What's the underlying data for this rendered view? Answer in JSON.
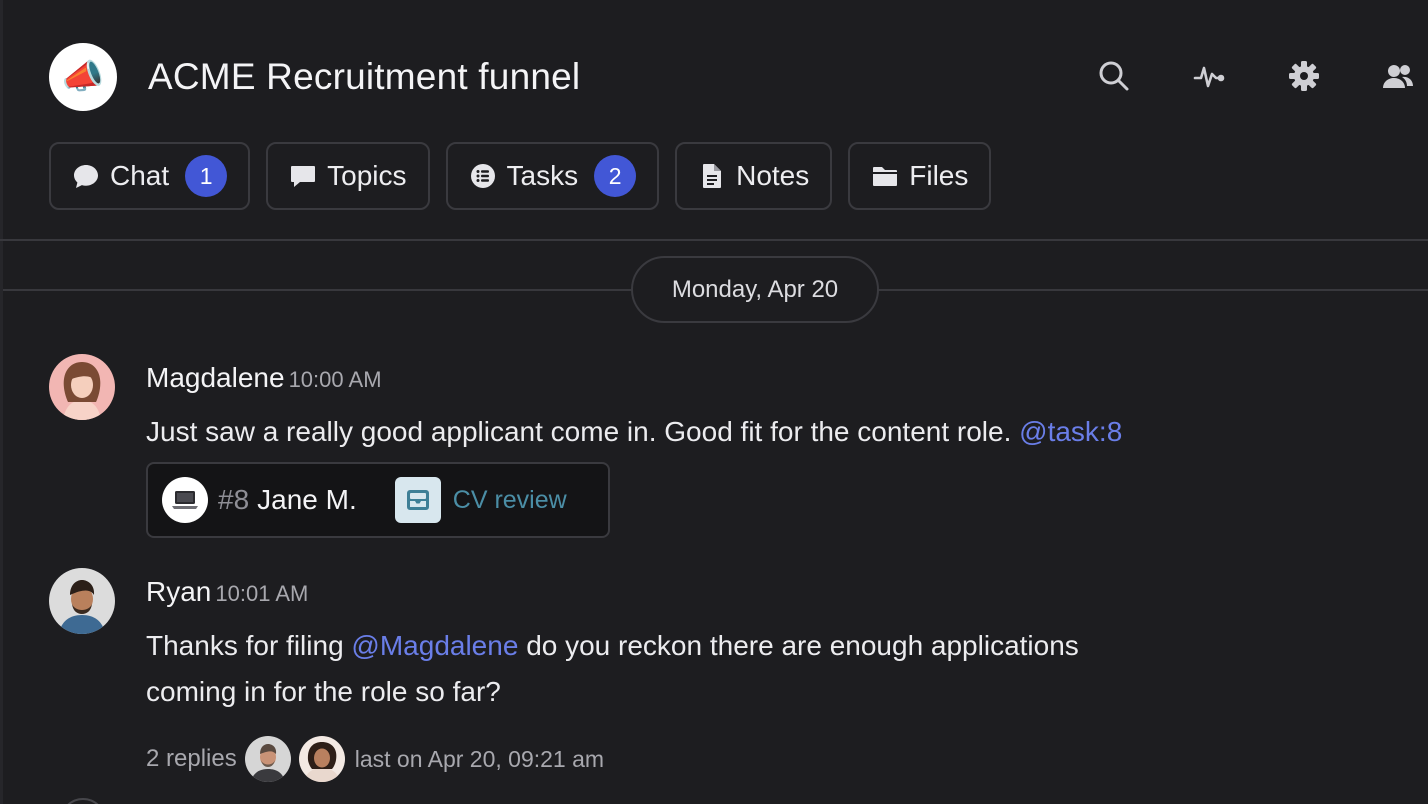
{
  "channel": {
    "title": "ACME Recruitment funnel",
    "avatar_icon": "megaphone-icon"
  },
  "header_icons": [
    "search-icon",
    "activity-icon",
    "gear-icon",
    "members-icon"
  ],
  "tabs": [
    {
      "label": "Chat",
      "icon": "chat-bubble-icon",
      "badge": "1"
    },
    {
      "label": "Topics",
      "icon": "topics-icon"
    },
    {
      "label": "Tasks",
      "icon": "tasks-icon",
      "badge": "2"
    },
    {
      "label": "Notes",
      "icon": "document-icon"
    },
    {
      "label": "Files",
      "icon": "folder-icon"
    }
  ],
  "date_divider": "Monday, Apr 20",
  "messages": [
    {
      "author": "Magdalene",
      "time": "10:00 AM",
      "text": "Just saw a really good applicant come in. Good fit for the content role.",
      "mention": "@task:8",
      "task": {
        "number": "#8",
        "name": "Jane M.",
        "status": "CV review",
        "icon": "laptop-icon",
        "status_icon": "inbox-icon"
      }
    },
    {
      "author": "Ryan",
      "time": "10:01 AM",
      "text_before": "Thanks for filing",
      "mention": "@Magdalene",
      "text_after_line1": "do you reckon there are enough applications",
      "text_line2": "coming in for the role so far?",
      "replies": {
        "count": "2 replies",
        "last": "last on Apr 20, 09:21 am"
      }
    }
  ],
  "colors": {
    "background": "#1d1d20",
    "accent": "#4257d6",
    "mention": "#6a7ee8",
    "status": "#4b8ea6"
  }
}
